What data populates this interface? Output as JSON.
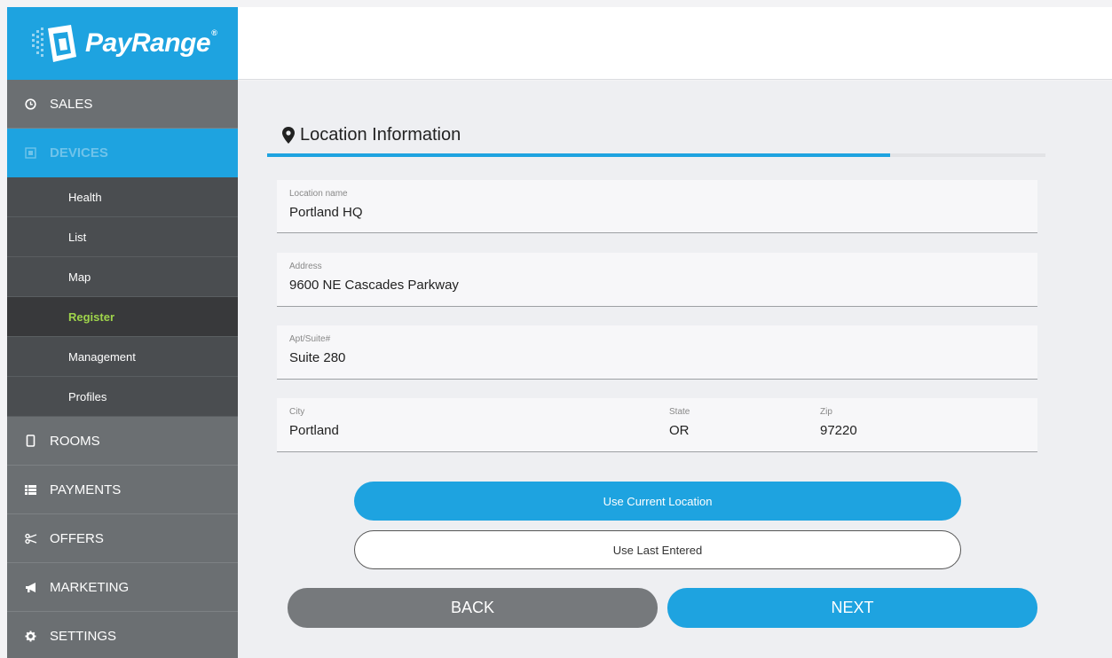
{
  "brand": {
    "name": "PayRange",
    "reg_mark": "®"
  },
  "sidebar": {
    "top_items": [
      {
        "label": "SALES",
        "icon": "clock-icon"
      },
      {
        "label": "DEVICES",
        "icon": "devices-icon",
        "active": true
      }
    ],
    "sub_items": [
      {
        "label": "Health"
      },
      {
        "label": "List"
      },
      {
        "label": "Map"
      },
      {
        "label": "Register",
        "active": true
      },
      {
        "label": "Management"
      },
      {
        "label": "Profiles"
      }
    ],
    "bottom_items": [
      {
        "label": "ROOMS",
        "icon": "phone-icon"
      },
      {
        "label": "PAYMENTS",
        "icon": "list-icon"
      },
      {
        "label": "OFFERS",
        "icon": "offers-icon"
      },
      {
        "label": "MARKETING",
        "icon": "megaphone-icon"
      },
      {
        "label": "SETTINGS",
        "icon": "gear-icon"
      }
    ]
  },
  "form": {
    "title": "Location Information",
    "progress_percent": 80,
    "location_name": {
      "label": "Location name",
      "value": "Portland HQ"
    },
    "address": {
      "label": "Address",
      "value": "9600 NE Cascades Parkway"
    },
    "apt": {
      "label": "Apt/Suite#",
      "value": "Suite 280"
    },
    "city": {
      "label": "City",
      "value": "Portland"
    },
    "state": {
      "label": "State",
      "value": "OR"
    },
    "zip": {
      "label": "Zip",
      "value": "97220"
    },
    "use_current_label": "Use Current Location",
    "use_last_label": "Use Last Entered",
    "back_label": "BACK",
    "next_label": "NEXT"
  },
  "colors": {
    "accent": "#1ea3e0",
    "sidebar": "#6b6f72",
    "submenu": "#4a4d50",
    "active_sub": "#9fd44b"
  }
}
